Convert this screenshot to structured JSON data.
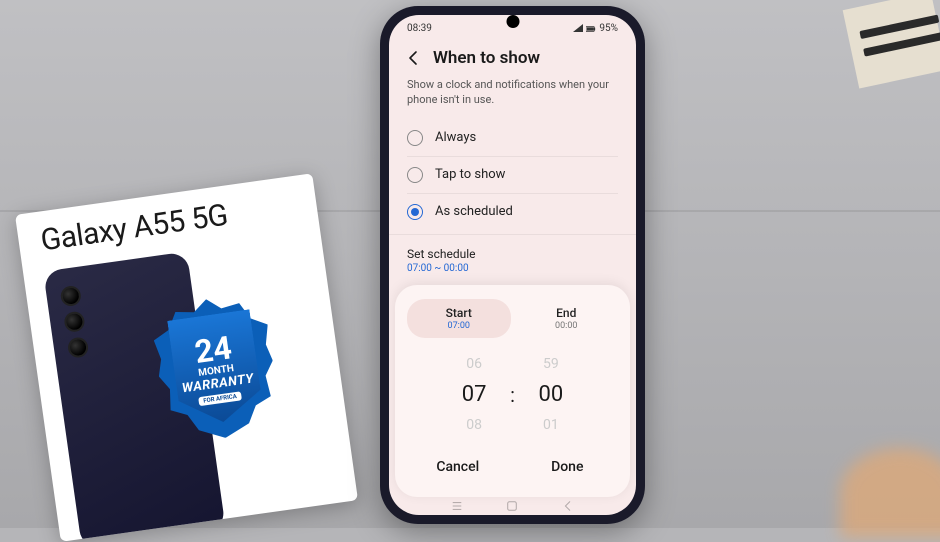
{
  "status_bar": {
    "time": "08:39",
    "battery": "95%"
  },
  "header": {
    "title": "When to show"
  },
  "description": "Show a clock and notifications when your phone isn't in use.",
  "options": [
    {
      "label": "Always",
      "selected": false
    },
    {
      "label": "Tap to show",
      "selected": false
    },
    {
      "label": "As scheduled",
      "selected": true
    }
  ],
  "schedule": {
    "title": "Set schedule",
    "range": "07:00 ~ 00:00"
  },
  "picker": {
    "tabs": {
      "start": {
        "label": "Start",
        "time": "07:00",
        "active": true
      },
      "end": {
        "label": "End",
        "time": "00:00",
        "active": false
      }
    },
    "wheel": {
      "hour_prev": "06",
      "hour": "07",
      "hour_next": "08",
      "min_prev": "59",
      "min": "00",
      "min_next": "01",
      "sep": ":"
    },
    "cancel": "Cancel",
    "done": "Done"
  },
  "product_box": {
    "title": "Galaxy A55 5G",
    "badge": {
      "num": "24",
      "unit": "MONTH",
      "label": "WARRANTY",
      "region": "FOR AFRICA"
    }
  }
}
